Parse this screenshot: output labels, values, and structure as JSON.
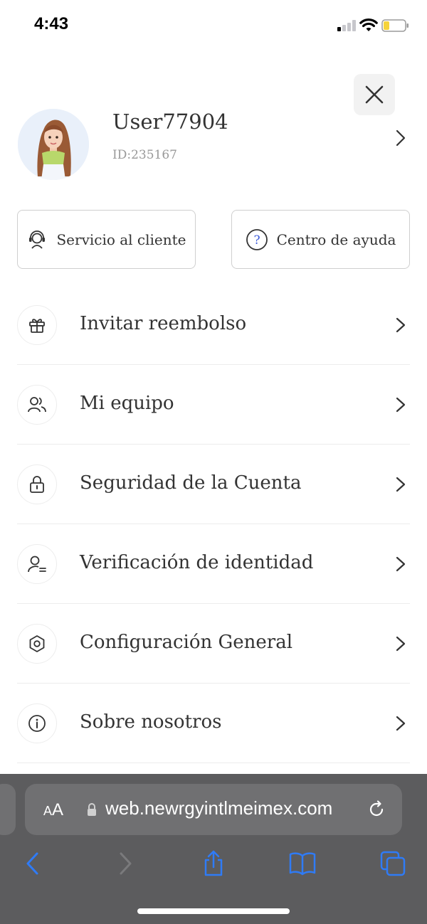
{
  "status_bar": {
    "time": "4:43",
    "signal_bars_active": 1,
    "signal_bars_total": 4,
    "battery_level": 0.25,
    "battery_color": "#f5d33b"
  },
  "profile": {
    "username": "User77904",
    "user_id": "ID:235167"
  },
  "quick_actions": {
    "customer_service": "Servicio al cliente",
    "help_center": "Centro de ayuda"
  },
  "menu": [
    {
      "label": "Invitar reembolso",
      "icon": "gift-icon"
    },
    {
      "label": "Mi equipo",
      "icon": "team-icon"
    },
    {
      "label": "Seguridad de la Cuenta",
      "icon": "lock-icon"
    },
    {
      "label": "Verificación de identidad",
      "icon": "user-verify-icon"
    },
    {
      "label": "Configuración General",
      "icon": "settings-icon"
    },
    {
      "label": "Sobre nosotros",
      "icon": "info-icon"
    }
  ],
  "browser": {
    "aa_small": "A",
    "aa_big": "A",
    "url": "web.newrgyintlmeimex.com",
    "accent_color": "#2f7bf6"
  }
}
